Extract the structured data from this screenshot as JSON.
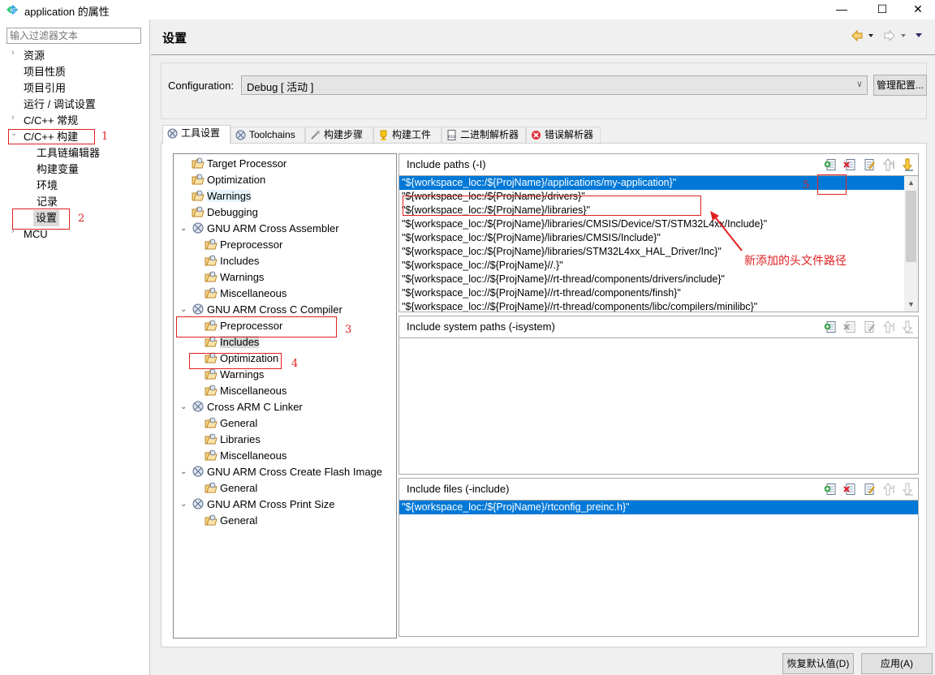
{
  "window": {
    "title": "application 的属性",
    "minimize": "—",
    "maximize": "☐",
    "close": "✕"
  },
  "sidebar": {
    "filter_placeholder": "输入过滤器文本",
    "items": [
      {
        "label": "资源",
        "expandable": true
      },
      {
        "label": "项目性质"
      },
      {
        "label": "项目引用"
      },
      {
        "label": "运行 / 调试设置"
      },
      {
        "label": "C/C++ 常规",
        "expandable": true
      },
      {
        "label": "C/C++ 构建",
        "expanded": true
      },
      {
        "label": "工具链编辑器"
      },
      {
        "label": "构建变量"
      },
      {
        "label": "环境"
      },
      {
        "label": "记录"
      },
      {
        "label": "设置",
        "selected": true
      },
      {
        "label": "MCU",
        "expandable": true
      }
    ]
  },
  "header": {
    "title": "设置"
  },
  "configuration": {
    "label": "Configuration:",
    "value": "Debug  [ 活动 ]",
    "manage_button": "管理配置..."
  },
  "tabs": [
    {
      "label": "工具设置",
      "icon": "tool-settings-icon",
      "active": true
    },
    {
      "label": "Toolchains",
      "icon": "toolchains-icon"
    },
    {
      "label": "构建步骤",
      "icon": "build-steps-icon"
    },
    {
      "label": "构建工件",
      "icon": "build-artifact-icon"
    },
    {
      "label": "二进制解析器",
      "icon": "binary-parser-icon"
    },
    {
      "label": "错误解析器",
      "icon": "error-parser-icon"
    }
  ],
  "tree": [
    {
      "label": "Target Processor",
      "level": 1
    },
    {
      "label": "Optimization",
      "level": 1
    },
    {
      "label": "Warnings",
      "level": 1,
      "highlighted": true
    },
    {
      "label": "Debugging",
      "level": 1
    },
    {
      "label": "GNU ARM Cross Assembler",
      "level": 0,
      "expanded": true
    },
    {
      "label": "Preprocessor",
      "level": 2
    },
    {
      "label": "Includes",
      "level": 2
    },
    {
      "label": "Warnings",
      "level": 2
    },
    {
      "label": "Miscellaneous",
      "level": 2
    },
    {
      "label": "GNU ARM Cross C Compiler",
      "level": 0,
      "expanded": true
    },
    {
      "label": "Preprocessor",
      "level": 2
    },
    {
      "label": "Includes",
      "level": 2,
      "selected": true
    },
    {
      "label": "Optimization",
      "level": 2
    },
    {
      "label": "Warnings",
      "level": 2
    },
    {
      "label": "Miscellaneous",
      "level": 2
    },
    {
      "label": "Cross ARM C Linker",
      "level": 0,
      "expanded": true
    },
    {
      "label": "General",
      "level": 2
    },
    {
      "label": "Libraries",
      "level": 2
    },
    {
      "label": "Miscellaneous",
      "level": 2
    },
    {
      "label": "GNU ARM Cross Create Flash Image",
      "level": 0,
      "expanded": true
    },
    {
      "label": "General",
      "level": 2
    },
    {
      "label": "GNU ARM Cross Print Size",
      "level": 0,
      "expanded": true
    },
    {
      "label": "General",
      "level": 2
    }
  ],
  "include_paths": {
    "title": "Include paths (-I)",
    "items": [
      "\"${workspace_loc:/${ProjName}/applications/my-application}\"",
      "\"${workspace_loc:/${ProjName}/drivers}\"",
      "\"${workspace_loc:/${ProjName}/libraries}\"",
      "\"${workspace_loc:/${ProjName}/libraries/CMSIS/Device/ST/STM32L4xx/Include}\"",
      "\"${workspace_loc:/${ProjName}/libraries/CMSIS/Include}\"",
      "\"${workspace_loc:/${ProjName}/libraries/STM32L4xx_HAL_Driver/Inc}\"",
      "\"${workspace_loc://${ProjName}//.}\"",
      "\"${workspace_loc://${ProjName}//rt-thread/components/drivers/include}\"",
      "\"${workspace_loc://${ProjName}//rt-thread/components/finsh}\"",
      "\"${workspace_loc://${ProjName}//rt-thread/components/libc/compilers/minilibc}\""
    ]
  },
  "include_system_paths": {
    "title": "Include system paths (-isystem)",
    "items": []
  },
  "include_files": {
    "title": "Include files (-include)",
    "items": [
      "\"${workspace_loc:/${ProjName}/rtconfig_preinc.h}\""
    ]
  },
  "toolbar_icons": [
    "add-icon",
    "delete-icon",
    "edit-icon",
    "move-up-icon",
    "move-down-icon"
  ],
  "annotations": {
    "n1": "1",
    "n2": "2",
    "n3": "3",
    "n4": "4",
    "n5": "5",
    "note": "新添加的头文件路径"
  },
  "buttons": {
    "restore_defaults": "恢复默认值(D)",
    "apply": "应用(A)"
  },
  "colors": {
    "selection": "#0078d7",
    "annotation": "#e02020"
  }
}
